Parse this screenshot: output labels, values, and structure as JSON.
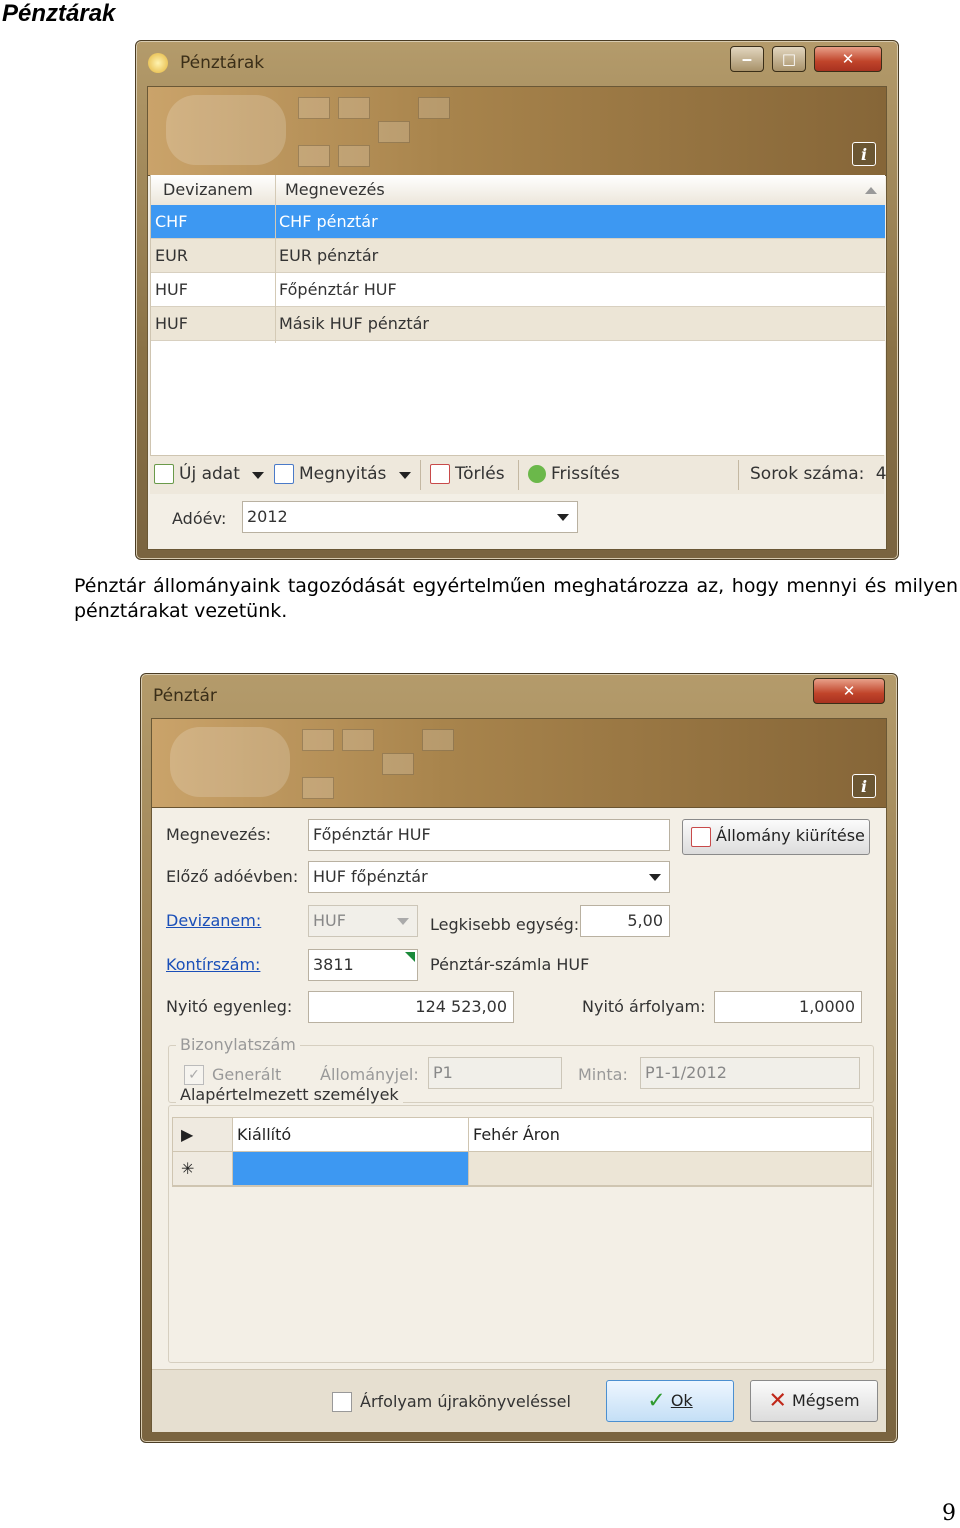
{
  "heading": "Pénztárak",
  "paragraph_line1": "Pénztár állományaink tagozódását egyértelműen meghatározza az, hogy mennyi és milyen",
  "paragraph_line2": "pénztárakat vezetünk.",
  "page_number": "9",
  "window1": {
    "title": "Pénztárak",
    "info_label": "i",
    "columns": [
      "Devizanem",
      "Megnevezés"
    ],
    "rows": [
      {
        "currency": "CHF",
        "name": "CHF pénztár",
        "selected": true
      },
      {
        "currency": "EUR",
        "name": "EUR pénztár",
        "selected": false
      },
      {
        "currency": "HUF",
        "name": "Főpénztár HUF",
        "selected": false
      },
      {
        "currency": "HUF",
        "name": "Másik HUF pénztár",
        "selected": false
      }
    ],
    "toolbar": {
      "new_label": "Új adat",
      "open_label": "Megnyitás",
      "delete_label": "Törlés",
      "refresh_label": "Frissítés",
      "row_count_label": "Sorok száma:",
      "row_count": "4"
    },
    "tax_year_label": "Adóév:",
    "tax_year_value": "2012"
  },
  "window2": {
    "title": "Pénztár",
    "info_label": "i",
    "name_label": "Megnevezés:",
    "name_value": "Főpénztár HUF",
    "clear_button": "Állomány kiürítése",
    "prev_year_label": "Előző adóévben:",
    "prev_year_value": "HUF főpénztár",
    "currency_label": "Devizanem:",
    "currency_value": "HUF",
    "min_unit_label": "Legkisebb egység:",
    "min_unit_value": "5,00",
    "account_label": "Kontírszám:",
    "account_value": "3811",
    "account_desc": "Pénztár-számla HUF",
    "opening_balance_label": "Nyitó egyenleg:",
    "opening_balance_value": "124 523,00",
    "opening_rate_label": "Nyitó árfolyam:",
    "opening_rate_value": "1,0000",
    "voucher_group_title": "Bizonylatszám",
    "generated_label": "Generált",
    "prefix_label": "Állományjel:",
    "prefix_value": "P1",
    "pattern_label": "Minta:",
    "pattern_value": "P1-1/2012",
    "persons_group_title": "Alapértelmezett személyek",
    "persons_rows": [
      {
        "marker": "▶",
        "role": "Kiállító",
        "person": "Fehér Áron"
      },
      {
        "marker": "✳",
        "role": "",
        "person": ""
      }
    ],
    "revalue_label": "Árfolyam újrakönyveléssel",
    "ok_label": "Ok",
    "cancel_label": "Mégsem"
  },
  "colors": {
    "selection": "#3d98f2",
    "title_bar": "#8a7246",
    "banner": "#a8844c",
    "link": "#1a4fb8"
  }
}
